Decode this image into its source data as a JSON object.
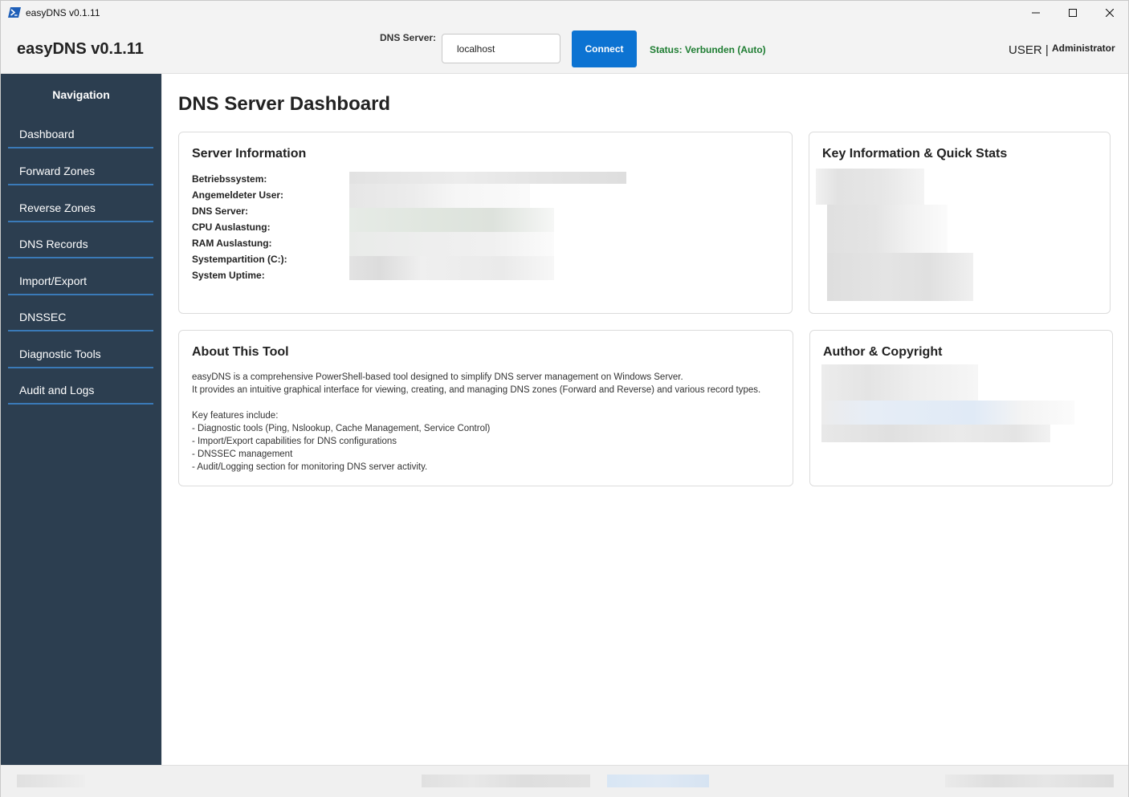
{
  "window": {
    "title": "easyDNS v0.1.11"
  },
  "header": {
    "brand": "easyDNS v0.1.11",
    "dns_server_label": "DNS Server:",
    "dns_server_value": "localhost",
    "connect_label": "Connect",
    "status": "Status: Verbunden (Auto)",
    "user_label": "USER |",
    "user_name": "Administrator"
  },
  "sidebar": {
    "title": "Navigation",
    "items": [
      {
        "label": "Dashboard"
      },
      {
        "label": "Forward Zones"
      },
      {
        "label": "Reverse Zones"
      },
      {
        "label": "DNS Records"
      },
      {
        "label": "Import/Export"
      },
      {
        "label": "DNSSEC"
      },
      {
        "label": "Diagnostic Tools"
      },
      {
        "label": "Audit and Logs"
      }
    ]
  },
  "main": {
    "title": "DNS Server Dashboard",
    "server_info": {
      "title": "Server Information",
      "rows": [
        {
          "label": "Betriebssystem:"
        },
        {
          "label": "Angemeldeter User:"
        },
        {
          "label": "DNS Server:"
        },
        {
          "label": "CPU Auslastung:"
        },
        {
          "label": "RAM Auslastung:"
        },
        {
          "label": "Systempartition (C:):"
        },
        {
          "label": "System Uptime:"
        }
      ]
    },
    "quick_stats": {
      "title": "Key Information & Quick Stats"
    },
    "about": {
      "title": "About This Tool",
      "lines": [
        "easyDNS is a comprehensive PowerShell-based tool designed to simplify DNS server management on Windows Server.",
        "It provides an intuitive graphical interface for viewing, creating, and managing DNS zones (Forward and Reverse) and various record types.",
        "",
        "Key features include:",
        "- Diagnostic tools (Ping, Nslookup, Cache Management, Service Control)",
        "- Import/Export capabilities for DNS configurations",
        "- DNSSEC management",
        "- Audit/Logging section for monitoring DNS server activity."
      ]
    },
    "author": {
      "title": "Author & Copyright"
    }
  },
  "colors": {
    "sidebar_bg": "#2c3e50",
    "accent": "#0c73d2",
    "status_ok": "#1e7d32",
    "nav_underline": "#3a7ab8"
  },
  "icons": {
    "app": "powershell-icon",
    "minimize": "minimize-icon",
    "maximize": "maximize-icon",
    "close": "close-icon"
  }
}
